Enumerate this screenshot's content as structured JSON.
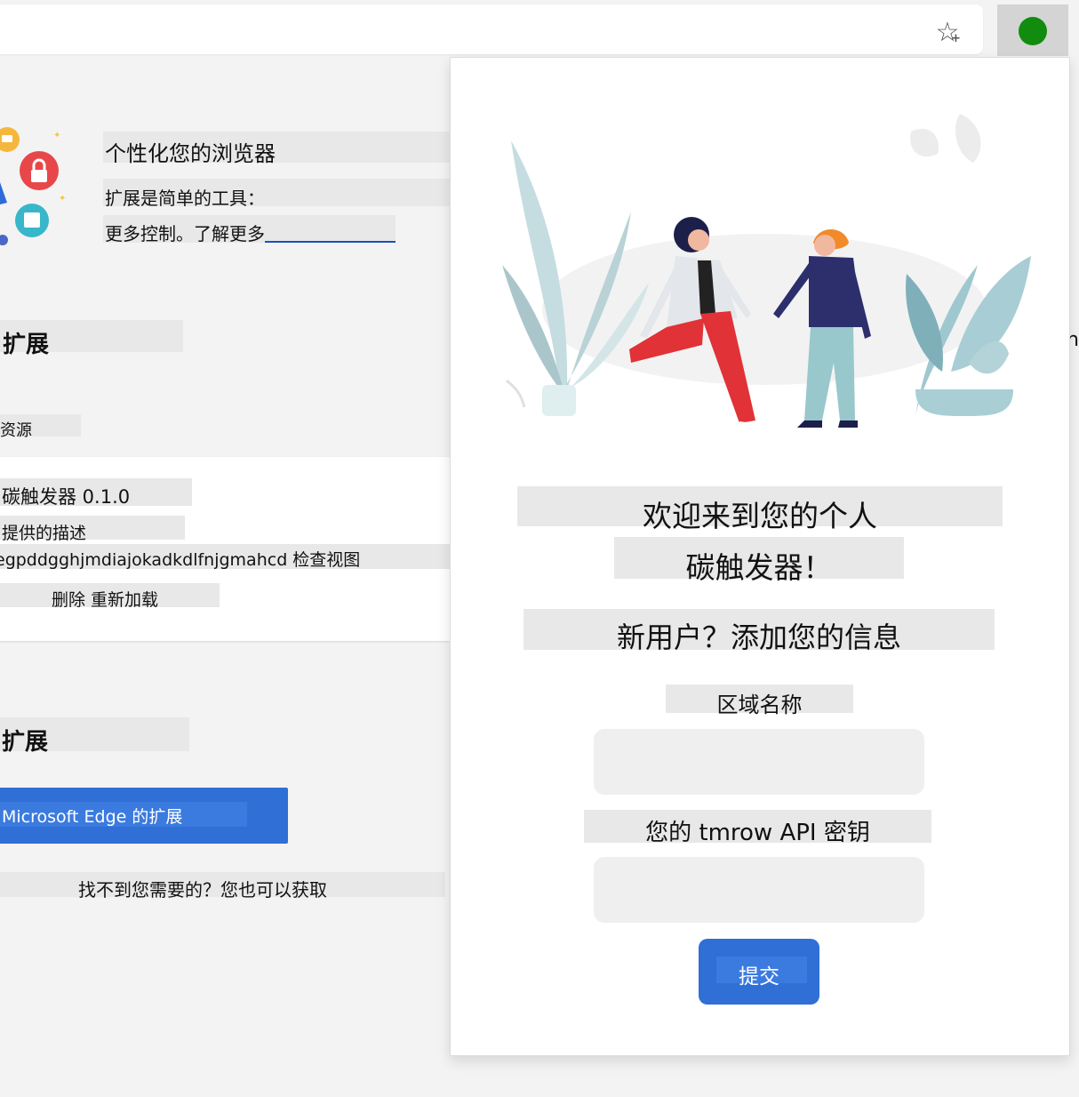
{
  "toolbar": {
    "favorite_icon": "star-plus-icon",
    "extension_icon": "green-circle-icon",
    "extension_color": "#118c0e"
  },
  "background_page": {
    "hero": {
      "title": "个性化您的浏览器",
      "line1": "扩展是简单的工具：",
      "line2": "更多控制。了解更多"
    },
    "section1_title": "扩展",
    "resources_label": "资源",
    "extension_card": {
      "name": "碳触发器 0.1.0",
      "description": "提供的描述",
      "id_line": "egpddgghjmdiajokadkdlfnjgmahcd 检查视图",
      "actions": "删除 重新加载"
    },
    "section2_title": "扩展",
    "edge_button": "Microsoft Edge 的扩展",
    "footer_text": "找不到您需要的？您也可以获取",
    "edge_char": "n"
  },
  "popup": {
    "welcome_line1": "欢迎来到您的个人",
    "welcome_line2": "碳触发器！",
    "new_user": "新用户？添加您的信息",
    "region_label": "区域名称",
    "region_value": "",
    "api_label": "您的 tmrow API 密钥",
    "api_value": "",
    "submit_label": "提交",
    "accent_color": "#2f6fd6"
  }
}
